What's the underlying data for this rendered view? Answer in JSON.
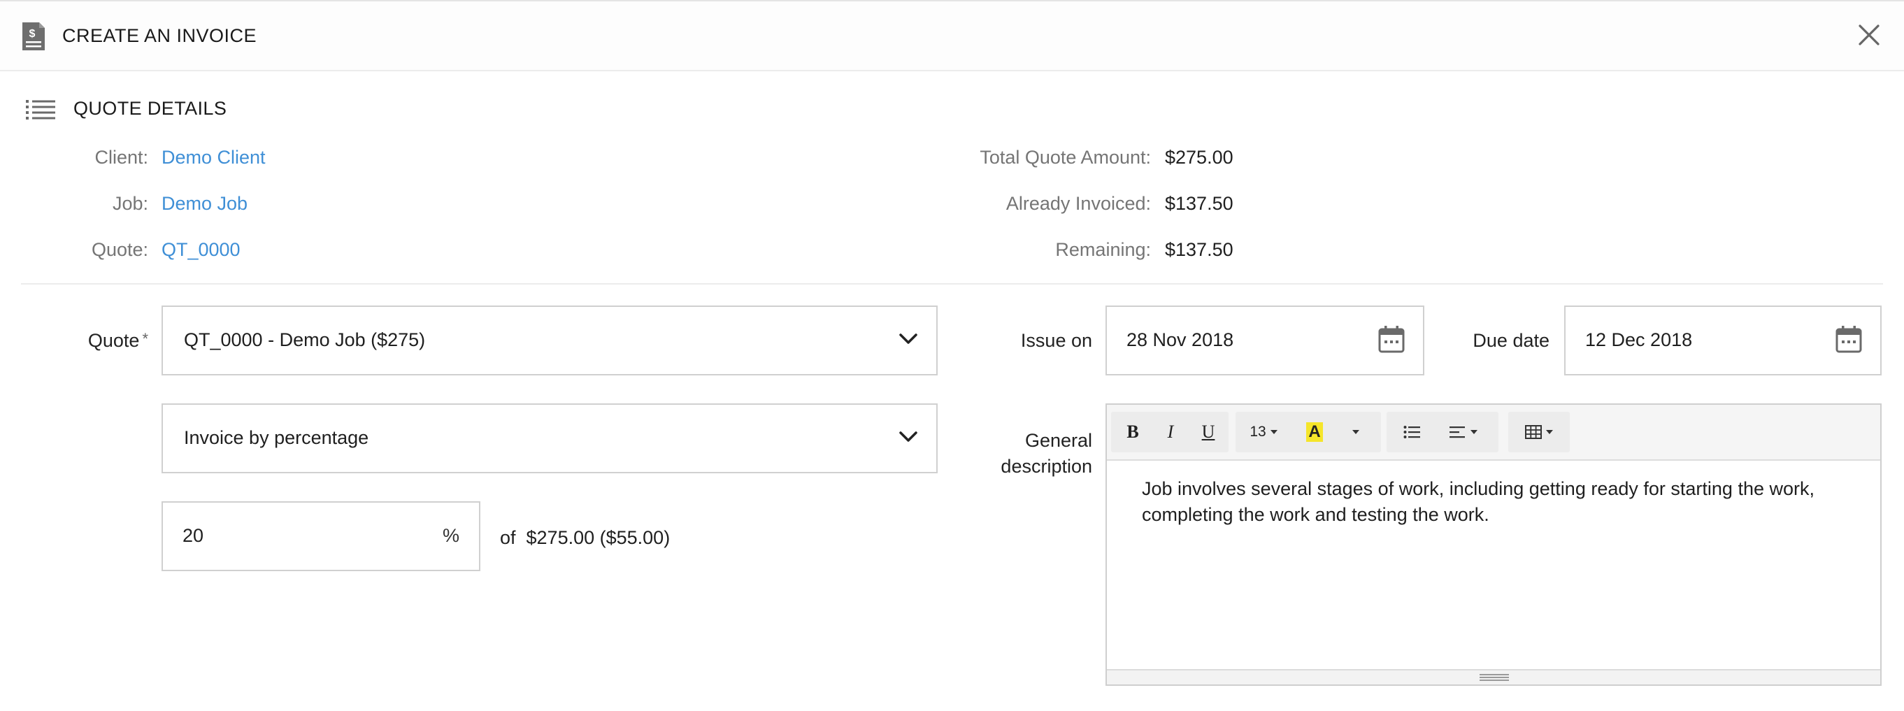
{
  "header": {
    "title": "CREATE AN INVOICE",
    "icon": "invoice-document-icon",
    "close_icon": "close-icon"
  },
  "quote_details": {
    "section_title": "QUOTE DETAILS",
    "section_icon": "list-icon",
    "left": [
      {
        "label": "Client:",
        "value": "Demo Client"
      },
      {
        "label": "Job:",
        "value": "Demo Job"
      },
      {
        "label": "Quote:",
        "value": "QT_0000"
      }
    ],
    "right": [
      {
        "label": "Total Quote Amount:",
        "value": "$275.00"
      },
      {
        "label": "Already Invoiced:",
        "value": "$137.50"
      },
      {
        "label": "Remaining:",
        "value": "$137.50"
      }
    ]
  },
  "form": {
    "quote_label": "Quote",
    "required_mark": "*",
    "quote_select_value": "QT_0000 - Demo Job ($275)",
    "invoice_type_value": "Invoice by percentage",
    "percentage_value": "20",
    "percent_sign": "%",
    "of_text": "of  $275.00 ($55.00)",
    "issue_on_label": "Issue on",
    "issue_on_value": "28 Nov 2018",
    "due_date_label": "Due date",
    "due_date_value": "12 Dec 2018",
    "general_description_label_line1": "General",
    "general_description_label_line2": "description"
  },
  "editor": {
    "toolbar": {
      "bold": "B",
      "italic": "I",
      "underline": "U",
      "font_size": "13",
      "highlight": "A"
    },
    "content": "Job involves several stages of work, including getting ready for starting the work, completing the work and testing the work."
  },
  "colors": {
    "link": "#3f8fd6",
    "label_muted": "#757575",
    "highlight_yellow": "#f5e52a"
  }
}
